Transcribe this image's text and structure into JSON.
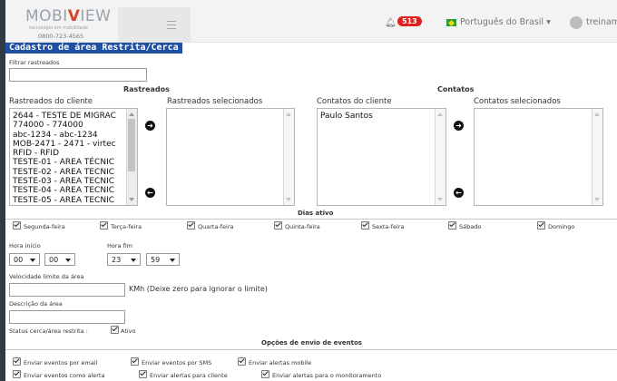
{
  "header": {
    "logo_name": "MOBIVIEW",
    "logo_tagline": "tecnologia em mobilidade",
    "logo_phone": "0800-723-4565",
    "notifications_count": "513",
    "language": "Português do Brasil ▾",
    "user": "treinam"
  },
  "title": "Cadastro de área Restrita/Cerca",
  "filter": {
    "label": "Filtrar rastreados",
    "value": ""
  },
  "rastreados": {
    "section": "Rastreados",
    "client_label": "Rastreados do cliente",
    "selected_label": "Rastreados selecionados",
    "items": [
      "2644 - TESTE DE MIGRAC",
      "774000 - 774000",
      "abc-1234 - abc-1234",
      "MOB-2471 - 2471 - virtec",
      "RFID - RFID",
      "TESTE-01 - AREA TÉCNIC",
      "TESTE-02 - AREA TECNIC",
      "TESTE-03 - AREA TECNIC",
      "TESTE-04 - AREA TECNIC",
      "TESTE-05 - AREA TECNIC"
    ]
  },
  "contatos": {
    "section": "Contatos",
    "client_label": "Contatos do cliente",
    "selected_label": "Contatos selecionados",
    "items": [
      "Paulo Santos"
    ]
  },
  "dias": {
    "label": "Dias ativo",
    "days": [
      "Segunda-feira",
      "Terça-feira",
      "Quarta-feira",
      "Quinta-feira",
      "Sexta-feira",
      "Sábado",
      "Domingo"
    ]
  },
  "hora_inicio": {
    "label": "Hora início",
    "hour": "00",
    "minute": "00"
  },
  "hora_fim": {
    "label": "Hora fim",
    "hour": "23",
    "minute": "59"
  },
  "velocidade": {
    "label": "Velocidade limite da área",
    "value": "",
    "hint": "KMh (Deixe zero para ignorar o limite)"
  },
  "descricao": {
    "label": "Descrição da área",
    "value": ""
  },
  "status": {
    "label": "Status cerca/área restrita :",
    "option": "Ativo"
  },
  "eventos": {
    "label": "Opções de envio de eventos",
    "row1": [
      "Enviar eventos por email",
      "Enviar eventos por SMS",
      "Enviar alertas mobile"
    ],
    "row2": [
      "Enviar eventos como alerta",
      "Enviar alertas para cliente",
      "Enviar alertas para o monitoramento"
    ]
  },
  "colors": {
    "title_bg": "#1f4fa0",
    "badge": "#e02020",
    "page_bg": "#2f3a44"
  }
}
